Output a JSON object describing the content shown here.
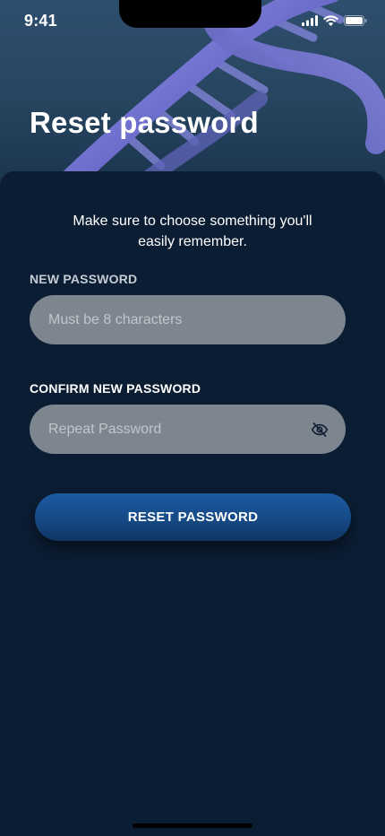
{
  "status_bar": {
    "time": "9:41",
    "icons": [
      "signal-icon",
      "wifi-icon",
      "battery-icon"
    ]
  },
  "header": {
    "title": "Reset password"
  },
  "form": {
    "subtitle": "Make sure to choose something you'll easily remember.",
    "new_password": {
      "label": "NEW PASSWORD",
      "placeholder": "Must be 8 characters",
      "value": ""
    },
    "confirm_password": {
      "label": "CONFIRM NEW PASSWORD",
      "placeholder": "Repeat Password",
      "value": "",
      "toggle_icon": "eye-off-icon"
    },
    "submit_label": "RESET PASSWORD"
  },
  "colors": {
    "sheet_background": "#0b1d33",
    "input_background": "#7d858f",
    "button_top": "#1d5aa0",
    "button_bottom": "#0f3563",
    "dna_color": "#6f6fc8"
  }
}
